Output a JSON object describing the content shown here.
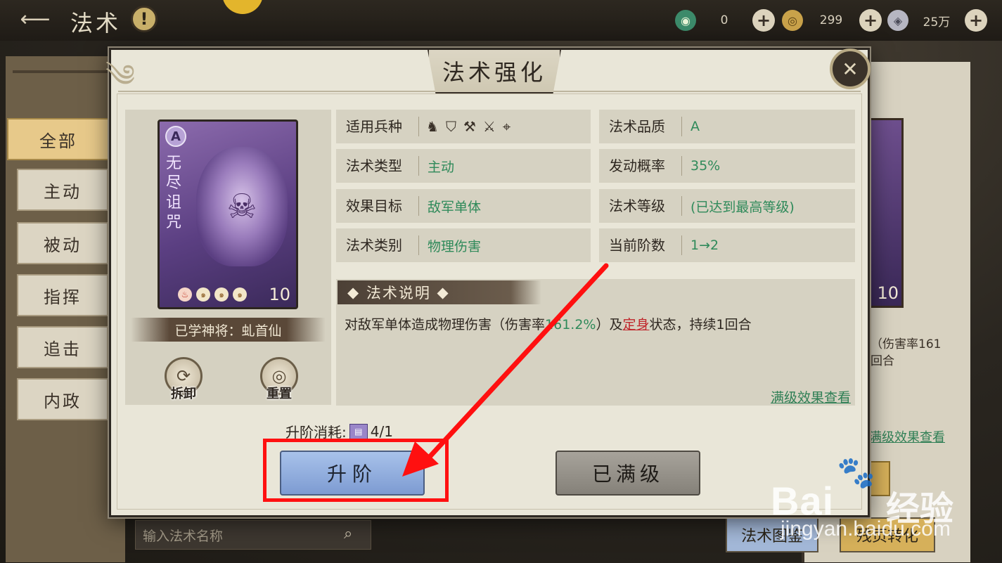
{
  "topbar": {
    "title": "法术",
    "help_icon": "exclamation-icon",
    "resources": [
      {
        "icon": "jade-icon",
        "value": "0"
      },
      {
        "icon": "gold-coin-icon",
        "value": "299"
      },
      {
        "icon": "silver-icon",
        "value": "25万"
      }
    ]
  },
  "sidebar": {
    "items": [
      {
        "label": "全部",
        "active": true
      },
      {
        "label": "主动"
      },
      {
        "label": "被动"
      },
      {
        "label": "指挥"
      },
      {
        "label": "追击"
      },
      {
        "label": "内政"
      }
    ]
  },
  "background": {
    "card_level": "10",
    "desc_line1": "（伤害率161",
    "desc_line2": "回合",
    "full_effect_link": "满级效果查看",
    "search_placeholder": "输入法术名称",
    "codex_button": "法术图鉴",
    "trade_button": "残页转化"
  },
  "modal": {
    "title": "法术强化",
    "card": {
      "grade": "A",
      "name": "无尽诅咒",
      "level": "10",
      "learned_by": "已学神将：虬首仙",
      "dismantle_label": "拆卸",
      "reset_label": "重置"
    },
    "info": {
      "troop_label": "适用兵种",
      "troop_icons": [
        "cavalry-icon",
        "shield-icon",
        "bow-icon",
        "spear-icon",
        "target-icon"
      ],
      "type_label": "法术类型",
      "type_value": "主动",
      "target_label": "效果目标",
      "target_value": "敌军单体",
      "category_label": "法术类别",
      "category_value": "物理伤害",
      "quality_label": "法术品质",
      "quality_value": "A",
      "chance_label": "发动概率",
      "chance_value": "35%",
      "level_label": "法术等级",
      "level_value": "(已达到最高等级)",
      "stage_label": "当前阶数",
      "stage_value": "1→2"
    },
    "description": {
      "title": "法术说明",
      "text_a": "对敌军单体造成物理伤害（伤害率",
      "text_num": "161.2%",
      "text_b": "）及",
      "text_red": "定身",
      "text_c": "状态，持续1回合",
      "full_effect_link": "满级效果查看"
    },
    "cost": {
      "label": "升阶消耗:",
      "value": "4/1"
    },
    "upgrade_button": "升阶",
    "maxed_button": "已满级"
  },
  "watermark": {
    "brand": "Bai",
    "brand_cn": "经验",
    "url": "jingyan.baidu.com"
  },
  "colors": {
    "accent_green": "#2f8a5a",
    "annotation_red": "#ff1010",
    "upgrade_blue": "#8fadde"
  }
}
